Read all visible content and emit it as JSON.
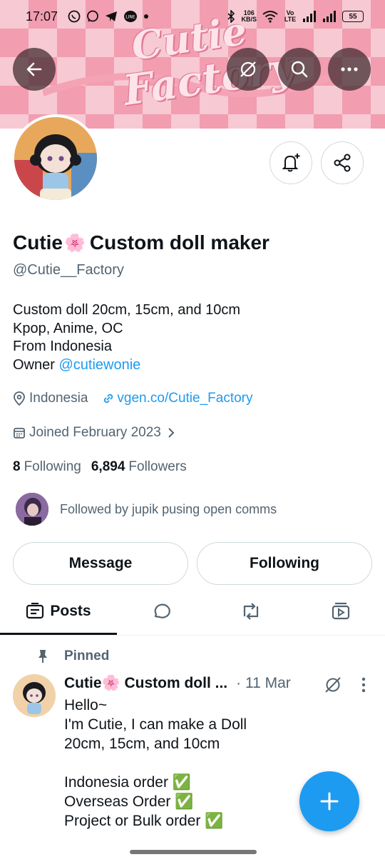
{
  "status_bar": {
    "time": "17:07",
    "speed_value": "106",
    "speed_unit": "KB/S",
    "network": "Vo LTE",
    "battery": "55"
  },
  "banner": {
    "logo_line1": "Cutie",
    "logo_line2": "Factory",
    "colors": {
      "pink_dark": "#f29db0",
      "pink_light": "#f7c9d3"
    }
  },
  "profile": {
    "name_part1": "Cutie",
    "name_emoji": "🌸",
    "name_part2": "Custom doll maker",
    "handle": "@Cutie__Factory",
    "bio_line1": "Custom doll 20cm, 15cm, and 10cm",
    "bio_line2": "Kpop, Anime, OC",
    "bio_line3": "From Indonesia",
    "bio_owner_prefix": "Owner",
    "bio_owner_link": "@cutiewonie",
    "location": "Indonesia",
    "website": "vgen.co/Cutie_Factory",
    "joined": "Joined February 2023",
    "following_count": "8",
    "following_label": "Following",
    "followers_count": "6,894",
    "followers_label": "Followers",
    "followed_by": "Followed by jupik pusing open comms"
  },
  "actions": {
    "message_label": "Message",
    "following_label": "Following"
  },
  "tabs": {
    "posts_label": "Posts"
  },
  "post": {
    "pinned_label": "Pinned",
    "author": "Cutie🌸 Custom doll ...",
    "date": "· 11 Mar",
    "body": "Hello~\nI'm Cutie, I can make a Doll\n20cm, 15cm, and 10cm\n\nIndonesia order ✅\nOverseas Order ✅\nProject or Bulk order ✅"
  },
  "colors": {
    "accent": "#1d9bf0",
    "text_primary": "#0f1419",
    "text_secondary": "#536471"
  }
}
